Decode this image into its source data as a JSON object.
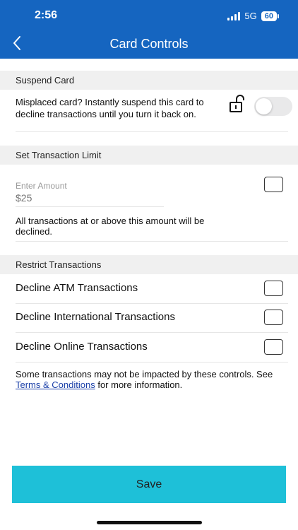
{
  "status_bar": {
    "time": "2:56",
    "network": "5G",
    "battery": "60"
  },
  "header": {
    "title": "Card Controls",
    "back_icon": "chevron-left-icon"
  },
  "suspend_card": {
    "section_title": "Suspend Card",
    "description": "Misplaced card? Instantly suspend this card to decline transactions until you turn it back on.",
    "lock_icon": "unlocked-padlock-icon",
    "toggle_on": false
  },
  "transaction_limit": {
    "section_title": "Set Transaction Limit",
    "amount_label": "Enter Amount",
    "amount_placeholder": "$25",
    "enabled": false,
    "note": "All transactions at or above this amount will be declined."
  },
  "restrict": {
    "section_title": "Restrict Transactions",
    "items": [
      {
        "label": "Decline ATM Transactions",
        "checked": false
      },
      {
        "label": "Decline International Transactions",
        "checked": false
      },
      {
        "label": "Decline Online Transactions",
        "checked": false
      }
    ]
  },
  "footnote": {
    "before": "Some transactions may not be impacted by these controls. See ",
    "link": "Terms & Conditions",
    "after": " for more information."
  },
  "save_label": "Save",
  "colors": {
    "header": "#1565c0",
    "save_button": "#1ec0d8",
    "link": "#1a3fa8"
  }
}
